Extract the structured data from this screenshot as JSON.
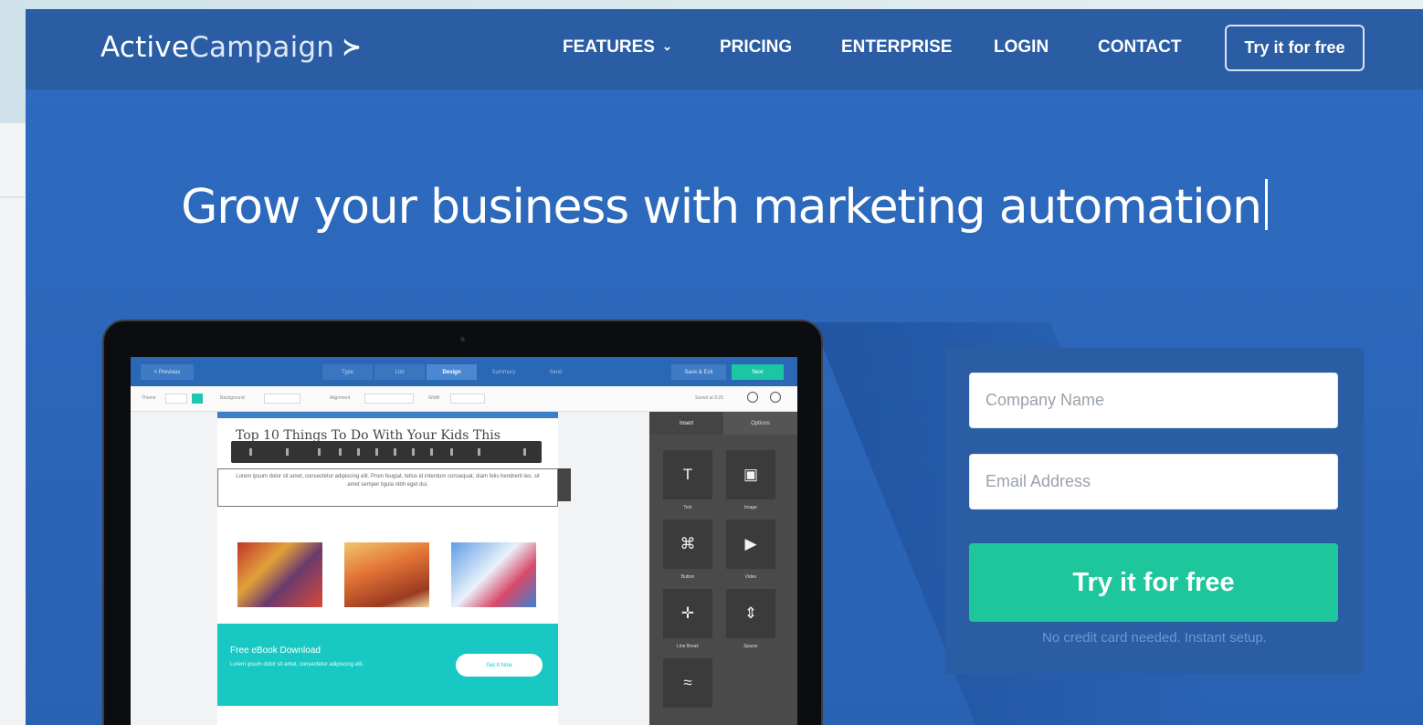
{
  "nav": {
    "logo_bold": "Active",
    "logo_light": "Campaign",
    "logo_chevron": "≻",
    "items": [
      "FEATURES",
      "PRICING",
      "ENTERPRISE",
      "LOGIN",
      "CONTACT"
    ],
    "features_caret": "⌄",
    "cta_label": "Try it for free"
  },
  "hero": {
    "headline_light": "Grow your business with ",
    "headline_bold": "marketing automation"
  },
  "mockup": {
    "prev_label": "< Previous",
    "steps": [
      "Type",
      "List",
      "Design",
      "Summary",
      "Send"
    ],
    "active_step": "Design",
    "save_label": "Save & Exit",
    "next_label": "Next",
    "tool_theme": "Theme",
    "tool_background": "Background",
    "tool_alignment": "Alignment",
    "tool_width": "Width",
    "tool_saved": "Saved at 9:25",
    "email_title": "Top 10 Things To Do With Your Kids This",
    "lorem": "Lorem ipsum dolor sit amet, consectetur adipiscing elit. Proin feugiat, tellus id interdum consequat, diam felis hendrerit leo, sit amet semper ligula nibh eget dui.",
    "banner_title": "Free eBook Download",
    "banner_sub": "Lorem ipsum dolor sit amet, consectetur adipiscing elit.",
    "banner_button": "Get It Now",
    "panel_tabs": [
      "Insert",
      "Options"
    ],
    "tiles": [
      {
        "icon": "text-icon",
        "glyph": "T",
        "label": "Text"
      },
      {
        "icon": "image-icon",
        "glyph": "▣",
        "label": "Image"
      },
      {
        "icon": "button-icon",
        "glyph": "⌘",
        "label": "Button"
      },
      {
        "icon": "video-icon",
        "glyph": "▶",
        "label": "Video"
      },
      {
        "icon": "line-break-icon",
        "glyph": "✛",
        "label": "Line Break"
      },
      {
        "icon": "spacer-icon",
        "glyph": "⇕",
        "label": "Spacer"
      },
      {
        "icon": "rss-icon",
        "glyph": "≈",
        "label": ""
      }
    ]
  },
  "form": {
    "company_placeholder": "Company Name",
    "email_placeholder": "Email Address",
    "cta_label": "Try it for free",
    "note": "No credit card needed. Instant setup."
  },
  "colors": {
    "brand_blue": "#2e6cc0",
    "nav_blue": "#2b5da4",
    "cta_green": "#1dc79b"
  }
}
